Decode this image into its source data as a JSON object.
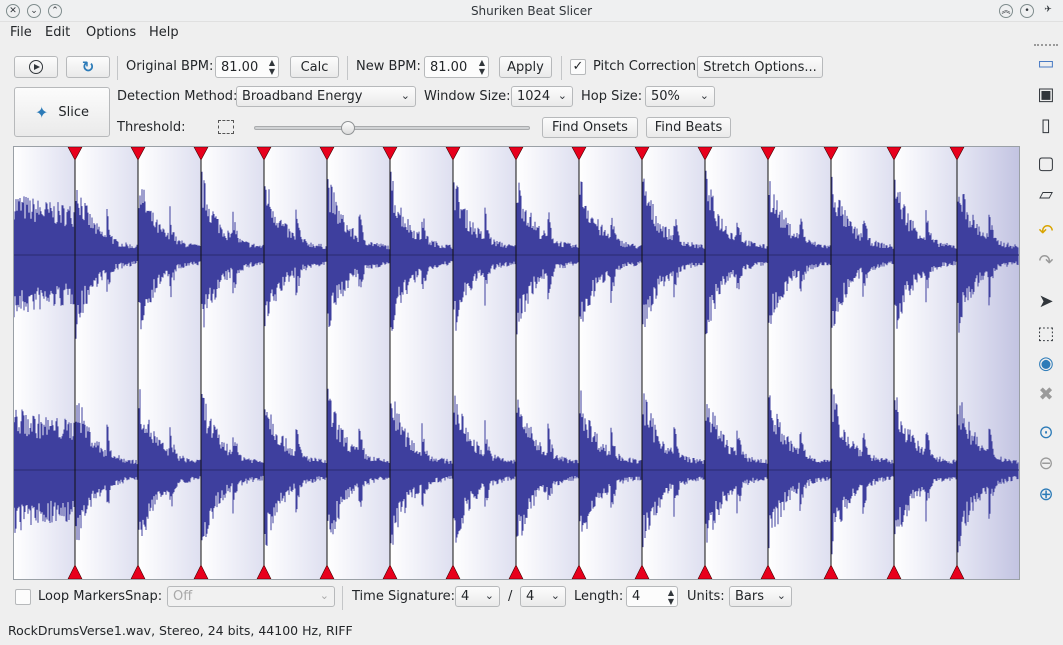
{
  "window": {
    "title": "Shuriken Beat Slicer"
  },
  "menu": [
    "File",
    "Edit",
    "Options",
    "Help"
  ],
  "toolbar": {
    "original_bpm_label": "Original BPM:",
    "original_bpm_value": "81.00",
    "calc_label": "Calc",
    "new_bpm_label": "New BPM:",
    "new_bpm_value": "81.00",
    "apply_label": "Apply",
    "pitch_correction_label": "Pitch Correction",
    "pitch_correction_checked": true,
    "stretch_options_label": "Stretch Options..."
  },
  "detection": {
    "slice_label": "Slice",
    "method_label": "Detection Method:",
    "method_value": "Broadband Energy",
    "window_size_label": "Window Size:",
    "window_size_value": "1024",
    "hop_size_label": "Hop Size:",
    "hop_size_value": "50%",
    "threshold_label": "Threshold:",
    "threshold_level": 0.33,
    "find_onsets_label": "Find Onsets",
    "find_beats_label": "Find Beats"
  },
  "waveform": {
    "slice_markers": 15,
    "wave_color": "#3e3f9e",
    "marker_color": "#e8001c",
    "background_color": "#e9e9f5"
  },
  "bottom": {
    "loop_markers_label": "Loop Markers",
    "snap_label": "Snap:",
    "snap_value": "Off",
    "time_signature_label": "Time Signature:",
    "time_sig_num": "4",
    "time_sig_slash": "/",
    "time_sig_den": "4",
    "length_label": "Length:",
    "length_value": "4",
    "units_label": "Units:",
    "units_value": "Bars"
  },
  "status": {
    "text": "RockDrumsVerse1.wav, Stereo, 24 bits, 44100 Hz, RIFF"
  },
  "sidebar_icons": [
    "open-file-icon",
    "save-icon",
    "close-file-icon",
    "import-icon",
    "export-icon",
    "undo-icon",
    "redo-icon",
    "select-icon",
    "rubberband-select-icon",
    "audition-icon",
    "delete-icon",
    "zoom-original-icon",
    "zoom-out-icon",
    "zoom-in-icon"
  ]
}
